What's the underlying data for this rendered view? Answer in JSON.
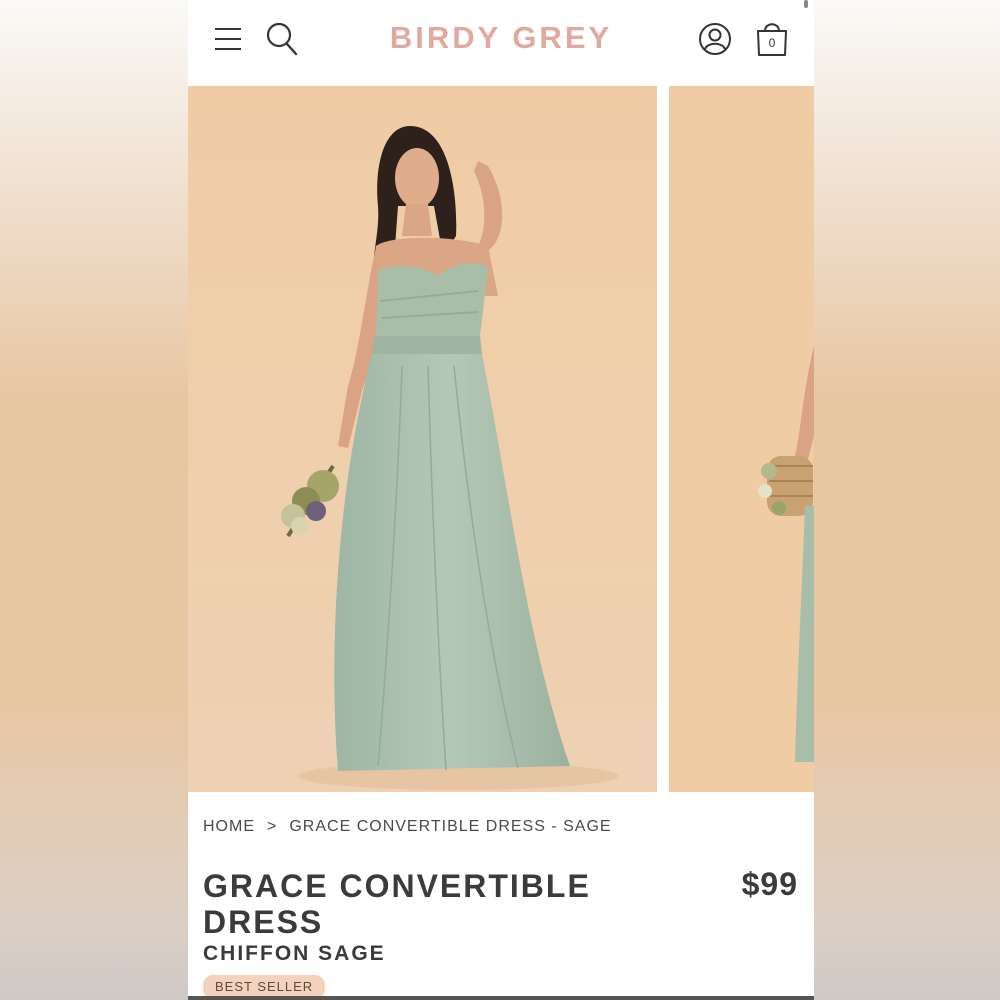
{
  "header": {
    "logo": "BIRDY GREY",
    "cart_count": "0"
  },
  "icons": {
    "menu": "hamburger-menu-icon",
    "search": "search-icon",
    "account": "account-icon",
    "bag": "shopping-bag-icon"
  },
  "colors": {
    "logo": "#e2a99f",
    "photo_bg": "#f0cda6",
    "dress": "#a9bfae",
    "badge_bg": "#f3d3bd",
    "text": "#3b3b3b"
  },
  "breadcrumb": {
    "home": "HOME",
    "separator": ">",
    "current": "GRACE CONVERTIBLE DRESS - SAGE"
  },
  "product": {
    "title": "GRACE CONVERTIBLE DRESS",
    "price": "$99",
    "subtitle": "CHIFFON SAGE",
    "badge": "BEST SELLER"
  }
}
